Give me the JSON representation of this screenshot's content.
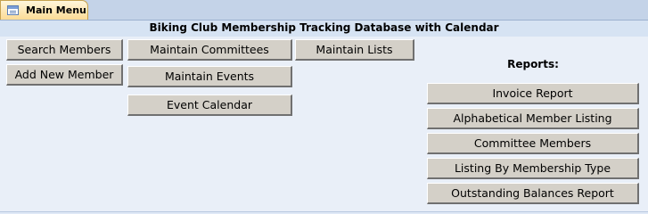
{
  "tab": {
    "label": "Main Menu",
    "icon": "form-icon"
  },
  "title": "Biking Club Membership Tracking Database with Calendar",
  "buttons": {
    "search_members": "Search Members",
    "add_new_member": "Add New Member",
    "maintain_committees": "Maintain Committees",
    "maintain_events": "Maintain Events",
    "event_calendar": "Event Calendar",
    "maintain_lists": "Maintain Lists"
  },
  "reports": {
    "label": "Reports:",
    "items": [
      "Invoice Report",
      "Alphabetical Member Listing",
      "Committee Members",
      "Listing By Membership Type",
      "Outstanding Balances Report"
    ]
  },
  "colors": {
    "background": "#e9eff8",
    "header": "#d6e3f3",
    "tab": "#fbdb95",
    "button": "#d4d0c8"
  }
}
